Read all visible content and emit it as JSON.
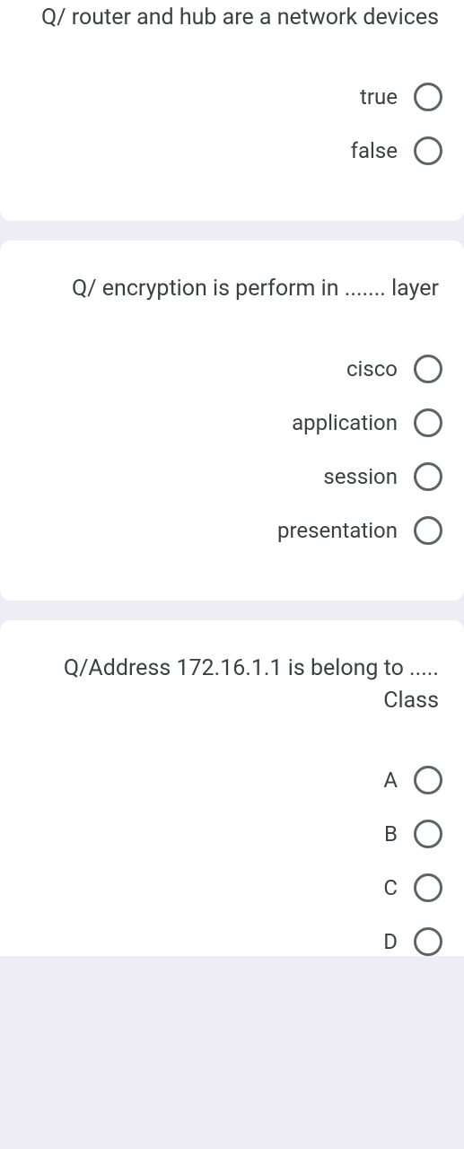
{
  "questions": [
    {
      "text": "Q/ router and hub are a network devices",
      "options": [
        "true",
        "false"
      ]
    },
    {
      "text": "Q/ encryption is perform in ....... layer",
      "options": [
        "cisco",
        "application",
        "session",
        "presentation"
      ]
    },
    {
      "text": "Q/Address 172.16.1.1 is belong to ..... Class",
      "options": [
        "A",
        "B",
        "C",
        "D"
      ]
    }
  ]
}
